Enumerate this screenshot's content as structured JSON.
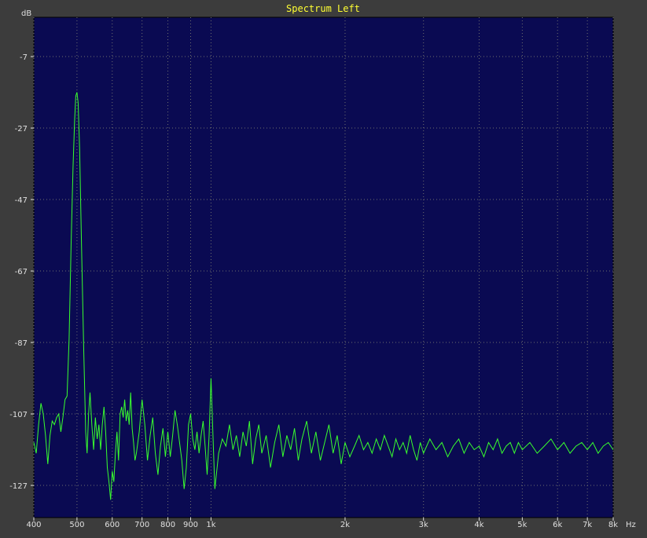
{
  "window": {
    "title": "Spectrum Left"
  },
  "colors": {
    "background": "#3c3c3c",
    "plot_bg": "#0a0a52",
    "grid": "#6f6f6f",
    "trace": "#39ff2e",
    "title": "#ffff33",
    "axis_text": "#e0e0e0"
  },
  "chart_data": {
    "type": "line",
    "title": "Spectrum Left",
    "xlabel": "Hz",
    "ylabel": "dB",
    "x_scale": "log",
    "xlim": [
      400,
      8000
    ],
    "ylim": [
      -136,
      4
    ],
    "grid": true,
    "xticks": [
      {
        "value": 400,
        "label": "400"
      },
      {
        "value": 500,
        "label": "500"
      },
      {
        "value": 600,
        "label": "600"
      },
      {
        "value": 700,
        "label": "700"
      },
      {
        "value": 800,
        "label": "800"
      },
      {
        "value": 900,
        "label": "900"
      },
      {
        "value": 1000,
        "label": "1k"
      },
      {
        "value": 2000,
        "label": "2k"
      },
      {
        "value": 3000,
        "label": "3k"
      },
      {
        "value": 4000,
        "label": "4k"
      },
      {
        "value": 5000,
        "label": "5k"
      },
      {
        "value": 6000,
        "label": "6k"
      },
      {
        "value": 7000,
        "label": "7k"
      },
      {
        "value": 8000,
        "label": "8k"
      }
    ],
    "yticks": [
      {
        "value": -7,
        "label": "-7"
      },
      {
        "value": -27,
        "label": "-27"
      },
      {
        "value": -47,
        "label": "-47"
      },
      {
        "value": -67,
        "label": "-67"
      },
      {
        "value": -87,
        "label": "-87"
      },
      {
        "value": -107,
        "label": "-107"
      },
      {
        "value": -127,
        "label": "-127"
      }
    ],
    "series": [
      {
        "points": [
          [
            400,
            -115
          ],
          [
            405,
            -118
          ],
          [
            410,
            -110
          ],
          [
            415,
            -104
          ],
          [
            420,
            -107
          ],
          [
            425,
            -113
          ],
          [
            430,
            -121
          ],
          [
            435,
            -113
          ],
          [
            440,
            -109
          ],
          [
            445,
            -110
          ],
          [
            450,
            -108
          ],
          [
            455,
            -107
          ],
          [
            460,
            -112
          ],
          [
            465,
            -108
          ],
          [
            470,
            -103
          ],
          [
            475,
            -102
          ],
          [
            480,
            -86
          ],
          [
            485,
            -60
          ],
          [
            490,
            -38
          ],
          [
            494,
            -25
          ],
          [
            497,
            -18
          ],
          [
            500,
            -17
          ],
          [
            503,
            -20
          ],
          [
            507,
            -33
          ],
          [
            512,
            -60
          ],
          [
            518,
            -90
          ],
          [
            523,
            -112
          ],
          [
            527,
            -118
          ],
          [
            531,
            -107
          ],
          [
            535,
            -101
          ],
          [
            540,
            -110
          ],
          [
            545,
            -117
          ],
          [
            550,
            -108
          ],
          [
            555,
            -114
          ],
          [
            560,
            -110
          ],
          [
            565,
            -117
          ],
          [
            570,
            -110
          ],
          [
            575,
            -105
          ],
          [
            580,
            -112
          ],
          [
            585,
            -122
          ],
          [
            590,
            -126
          ],
          [
            595,
            -131
          ],
          [
            600,
            -123
          ],
          [
            605,
            -126
          ],
          [
            610,
            -118
          ],
          [
            615,
            -112
          ],
          [
            620,
            -120
          ],
          [
            625,
            -107
          ],
          [
            630,
            -105
          ],
          [
            635,
            -108
          ],
          [
            640,
            -103
          ],
          [
            645,
            -109
          ],
          [
            650,
            -106
          ],
          [
            655,
            -110
          ],
          [
            660,
            -101
          ],
          [
            665,
            -111
          ],
          [
            670,
            -115
          ],
          [
            675,
            -120
          ],
          [
            680,
            -118
          ],
          [
            690,
            -112
          ],
          [
            700,
            -103
          ],
          [
            710,
            -110
          ],
          [
            720,
            -120
          ],
          [
            730,
            -113
          ],
          [
            740,
            -108
          ],
          [
            750,
            -118
          ],
          [
            760,
            -124
          ],
          [
            770,
            -116
          ],
          [
            780,
            -111
          ],
          [
            790,
            -119
          ],
          [
            800,
            -112
          ],
          [
            810,
            -119
          ],
          [
            820,
            -113
          ],
          [
            830,
            -106
          ],
          [
            840,
            -110
          ],
          [
            850,
            -115
          ],
          [
            860,
            -120
          ],
          [
            870,
            -128
          ],
          [
            880,
            -122
          ],
          [
            890,
            -110
          ],
          [
            900,
            -107
          ],
          [
            910,
            -114
          ],
          [
            920,
            -117
          ],
          [
            930,
            -112
          ],
          [
            940,
            -118
          ],
          [
            950,
            -113
          ],
          [
            960,
            -109
          ],
          [
            970,
            -116
          ],
          [
            980,
            -124
          ],
          [
            990,
            -113
          ],
          [
            1000,
            -97
          ],
          [
            1010,
            -113
          ],
          [
            1020,
            -128
          ],
          [
            1040,
            -118
          ],
          [
            1060,
            -114
          ],
          [
            1080,
            -116
          ],
          [
            1100,
            -110
          ],
          [
            1120,
            -117
          ],
          [
            1140,
            -113
          ],
          [
            1160,
            -119
          ],
          [
            1180,
            -112
          ],
          [
            1200,
            -116
          ],
          [
            1220,
            -109
          ],
          [
            1240,
            -121
          ],
          [
            1260,
            -114
          ],
          [
            1280,
            -110
          ],
          [
            1300,
            -118
          ],
          [
            1330,
            -113
          ],
          [
            1360,
            -122
          ],
          [
            1390,
            -115
          ],
          [
            1420,
            -110
          ],
          [
            1450,
            -119
          ],
          [
            1480,
            -113
          ],
          [
            1510,
            -117
          ],
          [
            1540,
            -111
          ],
          [
            1570,
            -120
          ],
          [
            1600,
            -114
          ],
          [
            1640,
            -109
          ],
          [
            1680,
            -118
          ],
          [
            1720,
            -112
          ],
          [
            1760,
            -120
          ],
          [
            1800,
            -115
          ],
          [
            1840,
            -110
          ],
          [
            1880,
            -118
          ],
          [
            1920,
            -113
          ],
          [
            1960,
            -121
          ],
          [
            2000,
            -115
          ],
          [
            2050,
            -119
          ],
          [
            2100,
            -116
          ],
          [
            2150,
            -113
          ],
          [
            2200,
            -117
          ],
          [
            2250,
            -115
          ],
          [
            2300,
            -118
          ],
          [
            2350,
            -114
          ],
          [
            2400,
            -117
          ],
          [
            2450,
            -113
          ],
          [
            2500,
            -116
          ],
          [
            2550,
            -119
          ],
          [
            2600,
            -114
          ],
          [
            2650,
            -117
          ],
          [
            2700,
            -115
          ],
          [
            2750,
            -118
          ],
          [
            2800,
            -113
          ],
          [
            2850,
            -117
          ],
          [
            2900,
            -120
          ],
          [
            2950,
            -115
          ],
          [
            3000,
            -118
          ],
          [
            3100,
            -114
          ],
          [
            3200,
            -117
          ],
          [
            3300,
            -115
          ],
          [
            3400,
            -119
          ],
          [
            3500,
            -116
          ],
          [
            3600,
            -114
          ],
          [
            3700,
            -118
          ],
          [
            3800,
            -115
          ],
          [
            3900,
            -117
          ],
          [
            4000,
            -116
          ],
          [
            4100,
            -119
          ],
          [
            4200,
            -115
          ],
          [
            4300,
            -117
          ],
          [
            4400,
            -114
          ],
          [
            4500,
            -118
          ],
          [
            4600,
            -116
          ],
          [
            4700,
            -115
          ],
          [
            4800,
            -118
          ],
          [
            4900,
            -115
          ],
          [
            5000,
            -117
          ],
          [
            5200,
            -115
          ],
          [
            5400,
            -118
          ],
          [
            5600,
            -116
          ],
          [
            5800,
            -114
          ],
          [
            6000,
            -117
          ],
          [
            6200,
            -115
          ],
          [
            6400,
            -118
          ],
          [
            6600,
            -116
          ],
          [
            6800,
            -115
          ],
          [
            7000,
            -117
          ],
          [
            7200,
            -115
          ],
          [
            7400,
            -118
          ],
          [
            7600,
            -116
          ],
          [
            7800,
            -115
          ],
          [
            8000,
            -117
          ]
        ]
      }
    ]
  }
}
